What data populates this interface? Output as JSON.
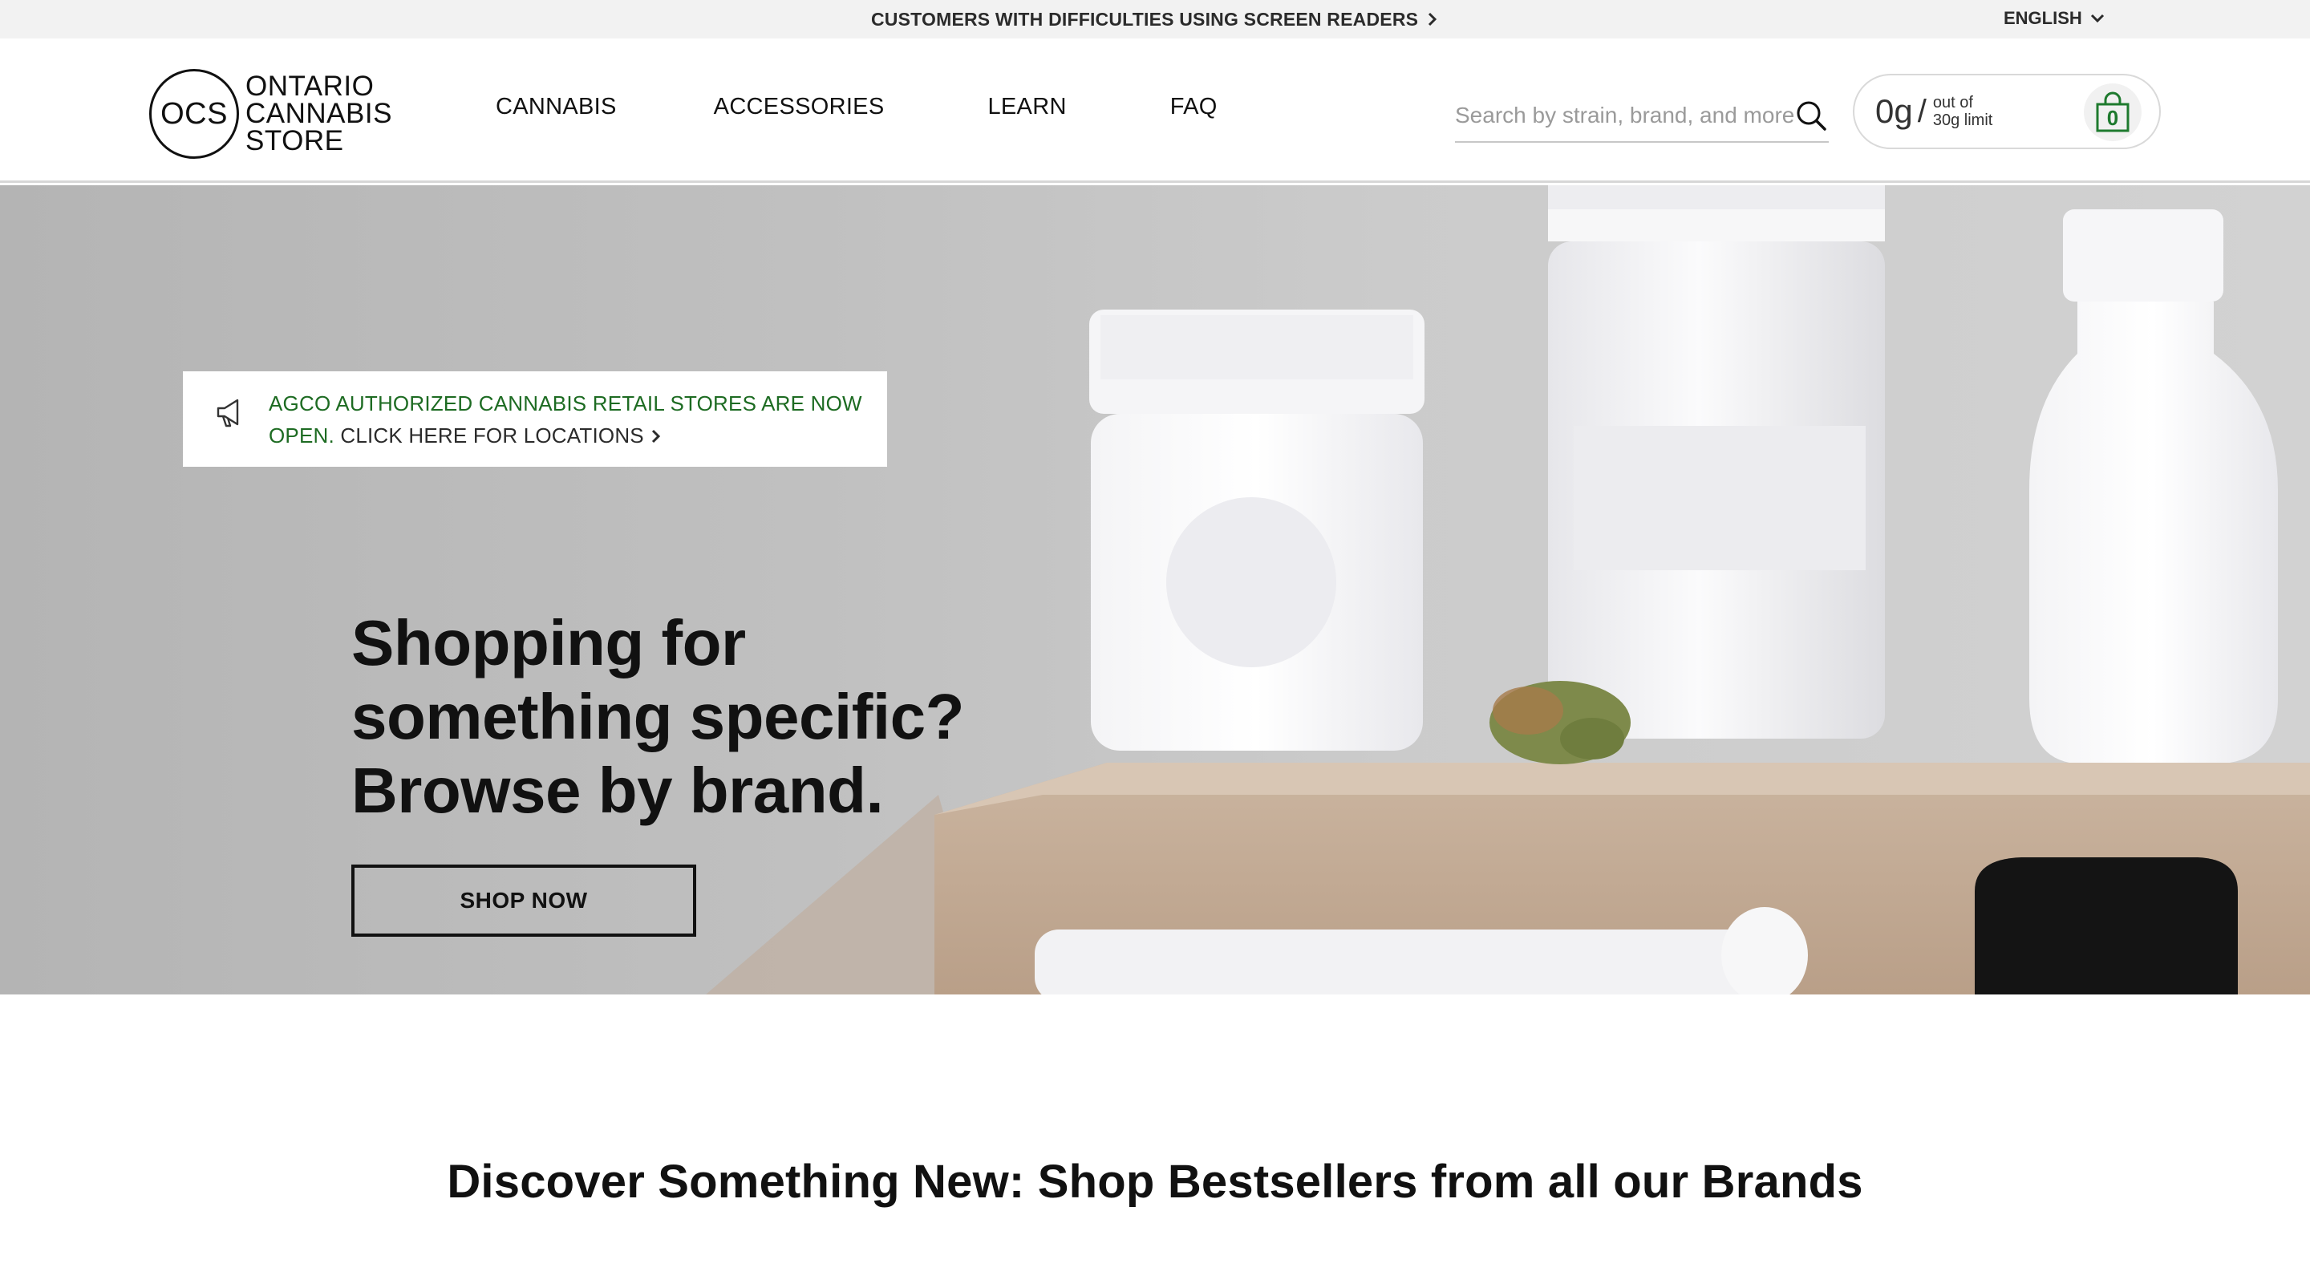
{
  "utility_bar": {
    "accessibility_link": "CUSTOMERS WITH DIFFICULTIES USING SCREEN READERS",
    "language": "ENGLISH"
  },
  "header": {
    "logo": {
      "monogram": "OCS",
      "line1": "ONTARIO",
      "line2": "CANNABIS",
      "line3": "STORE"
    },
    "nav": [
      {
        "label": "CANNABIS"
      },
      {
        "label": "ACCESSORIES"
      },
      {
        "label": "LEARN"
      },
      {
        "label": "FAQ"
      }
    ],
    "search": {
      "placeholder": "Search by strain, brand, and more"
    },
    "cart": {
      "grams": "0g",
      "slash": "/",
      "limit_line1": "out of",
      "limit_line2": "30g limit",
      "item_count": "0"
    }
  },
  "announcement": {
    "text": "AGCO AUTHORIZED CANNABIS RETAIL STORES ARE NOW OPEN.",
    "cta": "CLICK HERE FOR LOCATIONS"
  },
  "hero": {
    "title": "Shopping for something specific? Browse by brand.",
    "button": "SHOP NOW"
  },
  "section": {
    "title": "Discover Something New: Shop Bestsellers from all our Brands"
  },
  "colors": {
    "brand_green": "#1d6b22",
    "utility_bar_bg": "#f2f2f2",
    "text": "#111111"
  }
}
